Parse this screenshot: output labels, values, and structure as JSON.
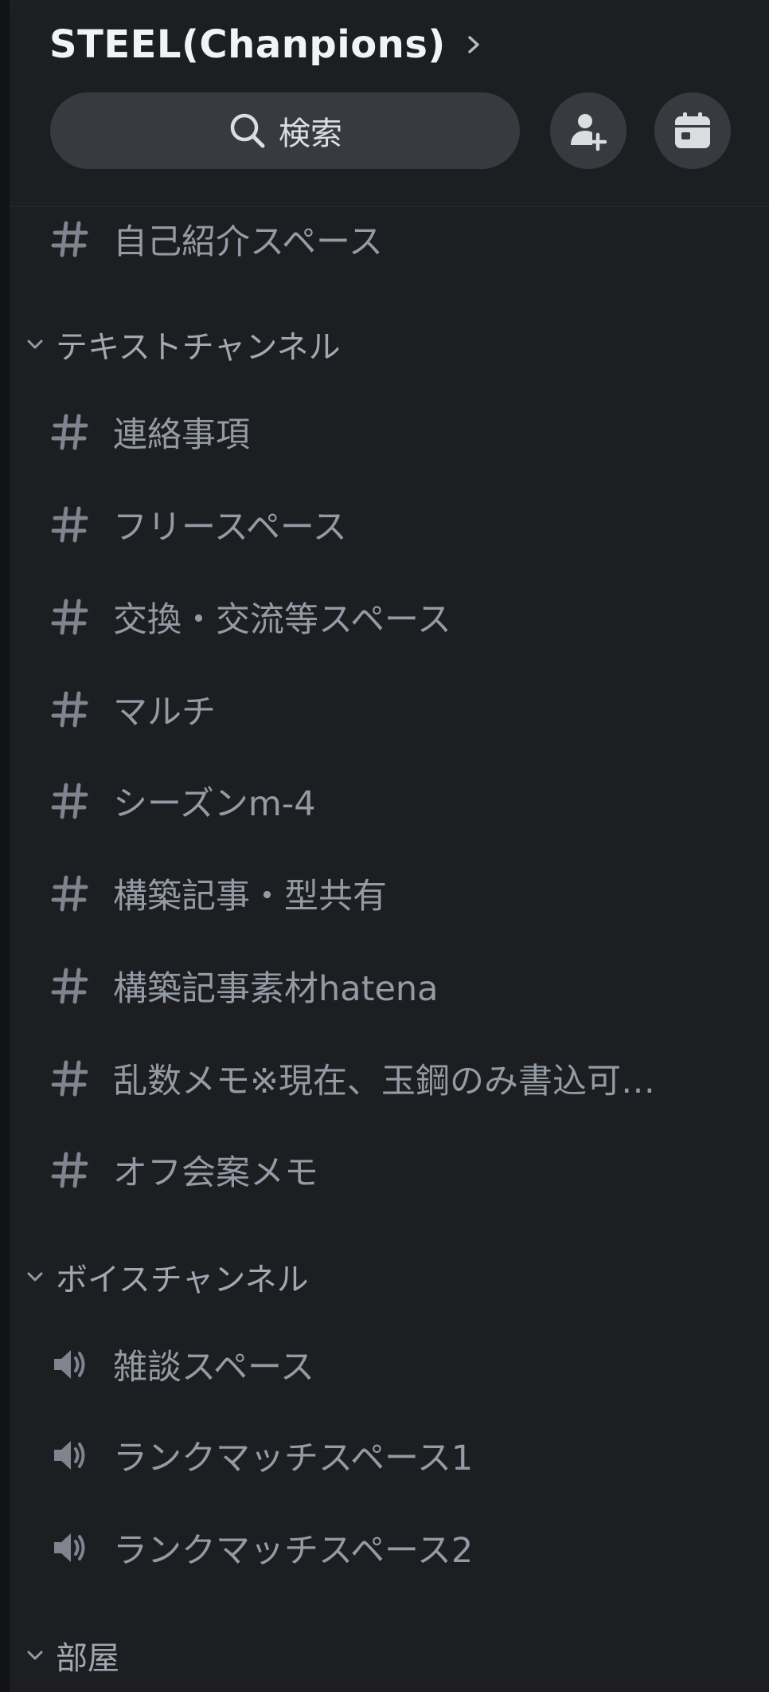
{
  "server": {
    "name": "STEEL(Chanpions)"
  },
  "search": {
    "label": "検索"
  },
  "header_buttons": {
    "invite_icon": "add-member-icon",
    "events_icon": "calendar-icon"
  },
  "top_channel": {
    "name": "自己紹介スペース",
    "icon": "hash-icon"
  },
  "categories": {
    "text": {
      "label": "テキストチャンネル",
      "channels": [
        {
          "name": "連絡事項",
          "icon": "hash-icon"
        },
        {
          "name": "フリースペース",
          "icon": "hash-icon"
        },
        {
          "name": "交換・交流等スペース",
          "icon": "hash-icon"
        },
        {
          "name": "マルチ",
          "icon": "hash-icon"
        },
        {
          "name": "シーズンm-4",
          "icon": "hash-icon"
        },
        {
          "name": "構築記事・型共有",
          "icon": "hash-icon"
        },
        {
          "name": "構築記事素材hatena",
          "icon": "hash-icon"
        },
        {
          "name": "乱数メモ※現在、玉鋼のみ書込可…",
          "icon": "hash-icon"
        },
        {
          "name": "オフ会案メモ",
          "icon": "hash-icon"
        }
      ]
    },
    "voice": {
      "label": "ボイスチャンネル",
      "channels": [
        {
          "name": "雑談スペース",
          "icon": "speaker-icon"
        },
        {
          "name": "ランクマッチスペース1",
          "icon": "speaker-icon"
        },
        {
          "name": "ランクマッチスペース2",
          "icon": "speaker-icon"
        }
      ]
    },
    "rooms": {
      "label": "部屋"
    }
  },
  "colors": {
    "background": "#1d1e22",
    "pill": "#383a40",
    "text_muted": "#949ba4",
    "text_header": "#f2f3f5"
  }
}
